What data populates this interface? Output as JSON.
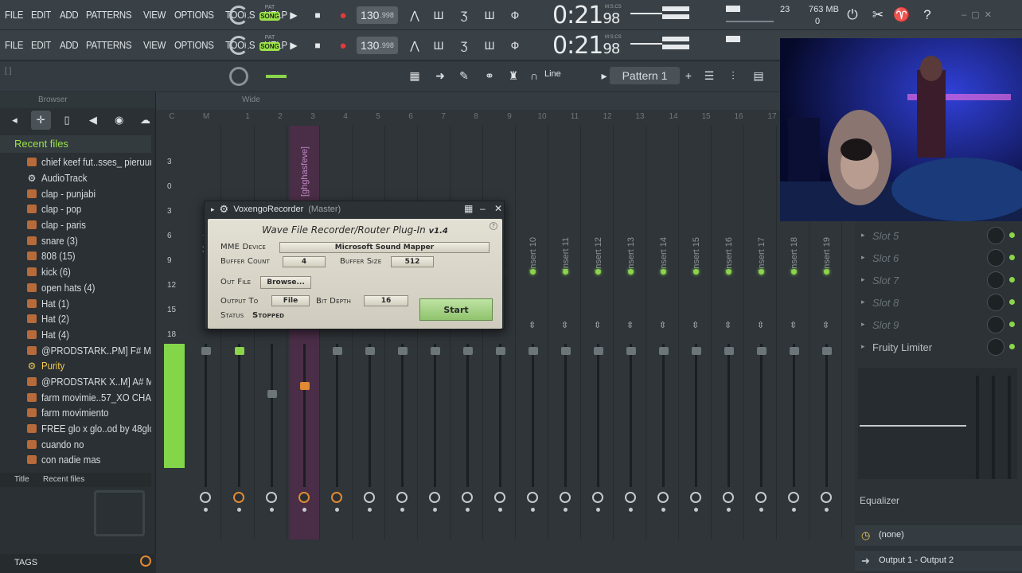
{
  "menu": [
    "FILE",
    "EDIT",
    "ADD",
    "PATTERNS",
    "VIEW",
    "OPTIONS",
    "TOOLS",
    "HELP"
  ],
  "transport": {
    "pat_label": "PAT",
    "song_label": "SONG",
    "tempo": "130",
    "tempo_frac": ".998",
    "time": "0:21",
    "time_frac": "98",
    "time_unit": "M:S:CS"
  },
  "cpu": {
    "cpu": "23",
    "mem": "763 MB",
    "voices": "0"
  },
  "toolbar": {
    "snap": "Line",
    "pattern": "Pattern 1",
    "hint": "[ ]"
  },
  "browser": {
    "header": "Browser",
    "title": "Recent files",
    "files": [
      {
        "name": "chief keef fut..sses_ pieruun",
        "type": "project"
      },
      {
        "name": "AudioTrack",
        "type": "gear"
      },
      {
        "name": "clap - punjabi",
        "type": "project"
      },
      {
        "name": "clap - pop",
        "type": "project"
      },
      {
        "name": "clap - paris",
        "type": "project"
      },
      {
        "name": "snare (3)",
        "type": "project"
      },
      {
        "name": "808 (15)",
        "type": "project"
      },
      {
        "name": "kick (6)",
        "type": "project"
      },
      {
        "name": "open hats (4)",
        "type": "project"
      },
      {
        "name": "Hat (1)",
        "type": "project"
      },
      {
        "name": "Hat (2)",
        "type": "project"
      },
      {
        "name": "Hat (4)",
        "type": "project"
      },
      {
        "name": "@PRODSTARK..PM] F# Major",
        "type": "project"
      },
      {
        "name": "Purity",
        "type": "gear",
        "highlight": true
      },
      {
        "name": "@PRODSTARK X..M] A# Minor",
        "type": "project"
      },
      {
        "name": "farm movimie..57_XO CHAIN",
        "type": "project"
      },
      {
        "name": "farm movimiento",
        "type": "project"
      },
      {
        "name": "FREE glo x glo..od by 48glock",
        "type": "project"
      },
      {
        "name": "cuando no",
        "type": "project"
      },
      {
        "name": "con nadie mas",
        "type": "project"
      }
    ],
    "col_title": "Title",
    "col_value": "Recent files",
    "tags": "TAGS"
  },
  "mixer": {
    "view": "Wide",
    "columns": [
      "C",
      "M",
      "1",
      "2",
      "3",
      "4",
      "5",
      "6",
      "7",
      "8",
      "9",
      "10",
      "11",
      "12",
      "13",
      "14",
      "15",
      "16",
      "17"
    ],
    "db_scale": [
      "3",
      "0",
      "3",
      "6",
      "9",
      "12",
      "15",
      "18"
    ],
    "master_label": "Master",
    "insert2_label": "[ghghasfeve]",
    "inserts": [
      "Insert 10",
      "Insert 11",
      "Insert 12",
      "Insert 13",
      "Insert 14",
      "Insert 15",
      "Insert 16",
      "Insert 17",
      "Insert 18",
      "Insert 19"
    ]
  },
  "rack": {
    "slots": [
      {
        "name": "Slot 5",
        "active": false
      },
      {
        "name": "Slot 6",
        "active": false
      },
      {
        "name": "Slot 7",
        "active": false
      },
      {
        "name": "Slot 8",
        "active": false
      },
      {
        "name": "Slot 9",
        "active": false
      },
      {
        "name": "Fruity Limiter",
        "active": true
      }
    ],
    "eq_label": "Equalizer",
    "input": "(none)",
    "output": "Output 1 - Output 2"
  },
  "plugin": {
    "title": "VoxengoRecorder",
    "subtitle": "(Master)",
    "heading": "Wave File Recorder/Router Plug-In",
    "version": "v1.4",
    "device_label": "MME Device",
    "device_value": "Microsoft Sound Mapper",
    "buffer_count_label": "Buffer Count",
    "buffer_count": "4",
    "buffer_size_label": "Buffer Size",
    "buffer_size": "512",
    "outfile_label": "Out File",
    "browse": "Browse...",
    "output_to_label": "Output To",
    "output_to": "File",
    "bit_depth_label": "Bit Depth",
    "bit_depth": "16",
    "start": "Start",
    "status_label": "Status",
    "status": "Stopped"
  },
  "colors": {
    "accent": "#9be24a",
    "record": "#e23b3b",
    "selected_strip": "#4a2e47",
    "fader_hot": "#e08a33"
  }
}
